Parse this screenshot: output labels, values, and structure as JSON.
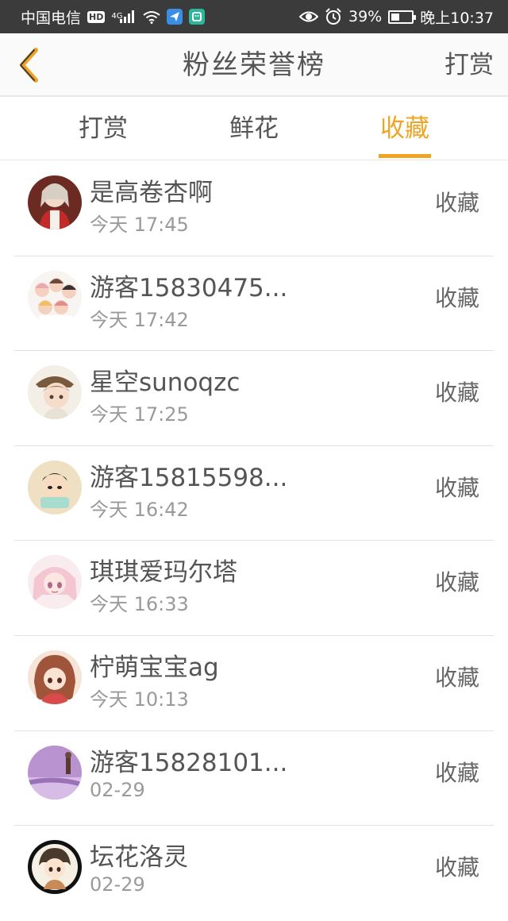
{
  "status_bar": {
    "carrier": "中国电信",
    "hd_badge": "HD",
    "network_type": "4G",
    "battery_percent_text": "39%",
    "battery_level": 0.39,
    "time": "晚上10:37",
    "icons": [
      "hd-icon",
      "signal-icon",
      "wifi-icon",
      "app-notification-icon",
      "app-notification-icon",
      "eye-icon",
      "alarm-icon",
      "battery-icon"
    ]
  },
  "header": {
    "title": "粉丝荣誉榜",
    "right_action": "打赏",
    "back_icon": "chevron-left-icon"
  },
  "tabs": [
    {
      "label": "打赏",
      "active": false
    },
    {
      "label": "鲜花",
      "active": false
    },
    {
      "label": "收藏",
      "active": true
    }
  ],
  "colors": {
    "accent": "#f0a424",
    "status_bar": "#3b3b3b",
    "text": "#555555",
    "subtext": "#9a9a9a"
  },
  "fans": [
    {
      "name": "是高卷杏啊",
      "time": "今天 17:45",
      "action": "收藏"
    },
    {
      "name": "游客15830475...",
      "time": "今天 17:42",
      "action": "收藏"
    },
    {
      "name": "星空sunoqzc",
      "time": "今天 17:25",
      "action": "收藏"
    },
    {
      "name": "游客15815598...",
      "time": "今天 16:42",
      "action": "收藏"
    },
    {
      "name": "琪琪爱玛尔塔",
      "time": "今天 16:33",
      "action": "收藏"
    },
    {
      "name": "柠萌宝宝ag",
      "time": "今天 10:13",
      "action": "收藏"
    },
    {
      "name": "游客15828101...",
      "time": "02-29",
      "action": "收藏"
    },
    {
      "name": "坛花洛灵",
      "time": "02-29",
      "action": "收藏"
    }
  ]
}
